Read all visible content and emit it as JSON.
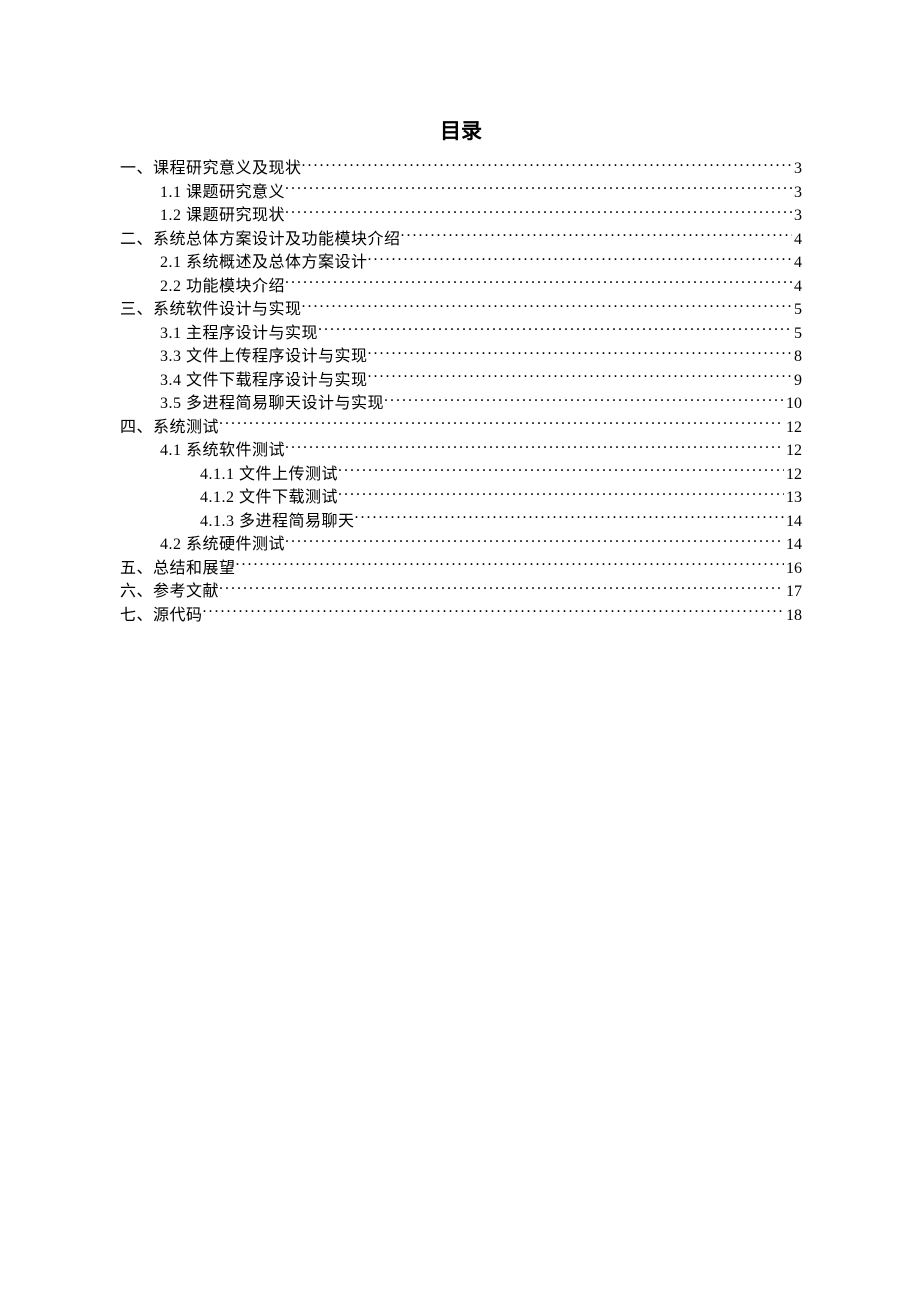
{
  "title": "目录",
  "entries": [
    {
      "level": 1,
      "label": "一、课程研究意义及现状",
      "page": "3",
      "space": false
    },
    {
      "level": 2,
      "label": "1.1 课题研究意义",
      "page": "3",
      "space": false
    },
    {
      "level": 2,
      "label": "1.2 课题研究现状",
      "page": "3",
      "space": false
    },
    {
      "level": 1,
      "label": "二、系统总体方案设计及功能模块介绍",
      "page": "4",
      "space": false
    },
    {
      "level": 2,
      "label": "2.1  系统概述及总体方案设计",
      "page": "4",
      "space": true
    },
    {
      "level": 2,
      "label": "2.2 功能模块介绍",
      "page": "4",
      "space": false
    },
    {
      "level": 1,
      "label": "三、系统软件设计与实现",
      "page": "5",
      "space": false
    },
    {
      "level": 2,
      "label": "3.1 主程序设计与实现",
      "page": "5",
      "space": false
    },
    {
      "level": 2,
      "label": "3.3 文件上传程序设计与实现",
      "page": "8",
      "space": false
    },
    {
      "level": 2,
      "label": "3.4 文件下载程序设计与实现",
      "page": "9",
      "space": false
    },
    {
      "level": 2,
      "label": "3.5 多进程简易聊天设计与实现",
      "page": "10",
      "space": false
    },
    {
      "level": 1,
      "label": "四、系统测试",
      "page": "12",
      "space": false
    },
    {
      "level": 2,
      "label": "4.1 系统软件测试",
      "page": "12",
      "space": false
    },
    {
      "level": 3,
      "label": "4.1.1 文件上传测试",
      "page": "12",
      "space": true
    },
    {
      "level": 3,
      "label": "4.1.2 文件下载测试",
      "page": "13",
      "space": true
    },
    {
      "level": 3,
      "label": "4.1.3 多进程简易聊天",
      "page": "14",
      "space": true
    },
    {
      "level": 2,
      "label": "4.2 系统硬件测试",
      "page": "14",
      "space": false
    },
    {
      "level": 1,
      "label": "五、总结和展望",
      "page": "16",
      "space": false
    },
    {
      "level": 1,
      "label": "六、参考文献",
      "page": "17",
      "space": false
    },
    {
      "level": 1,
      "label": "七、源代码",
      "page": "18",
      "space": false
    }
  ]
}
